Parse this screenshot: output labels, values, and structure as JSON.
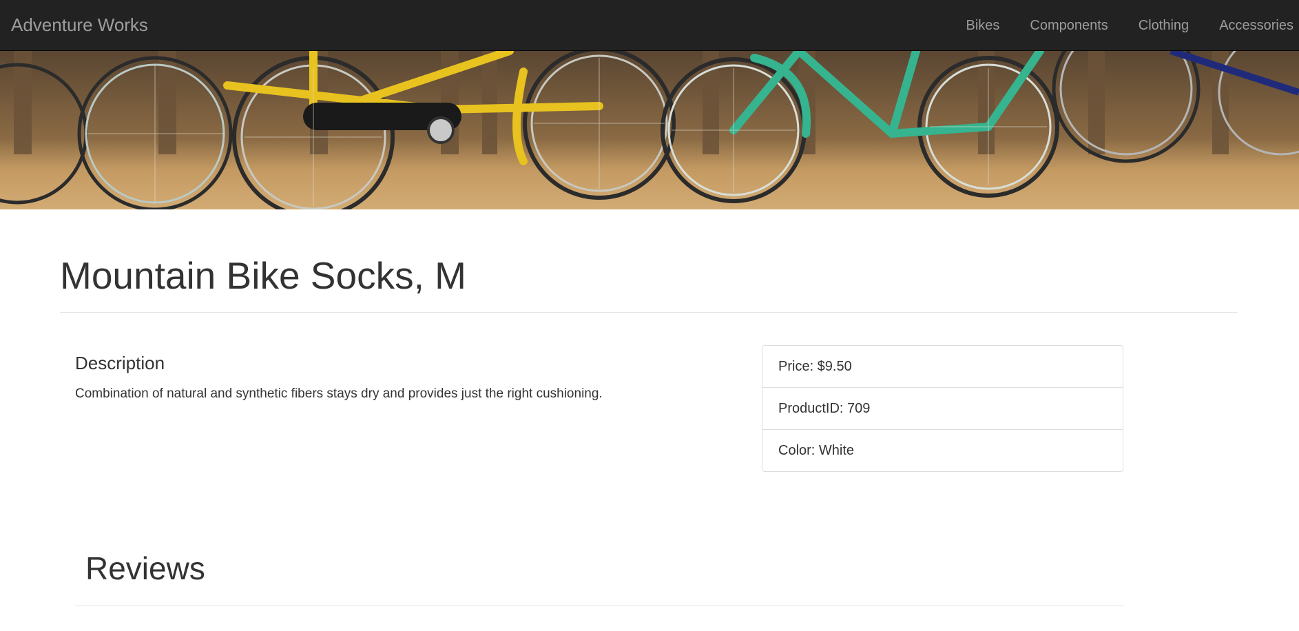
{
  "navbar": {
    "brand": "Adventure Works",
    "items": [
      {
        "label": "Bikes"
      },
      {
        "label": "Components"
      },
      {
        "label": "Clothing"
      },
      {
        "label": "Accessories"
      }
    ]
  },
  "hero": {
    "image": "bicycles-banner"
  },
  "product": {
    "title": "Mountain Bike Socks, M",
    "description_heading": "Description",
    "description": "Combination of natural and synthetic fibers stays dry and provides just the right cushioning.",
    "details": [
      {
        "text": "Price: $9.50"
      },
      {
        "text": "ProductID: 709"
      },
      {
        "text": "Color: White"
      }
    ]
  },
  "reviews": {
    "heading": "Reviews"
  },
  "colors": {
    "navbar_bg": "#222222",
    "nav_text": "#9d9d9d",
    "text": "#333333",
    "border": "#dddddd"
  }
}
